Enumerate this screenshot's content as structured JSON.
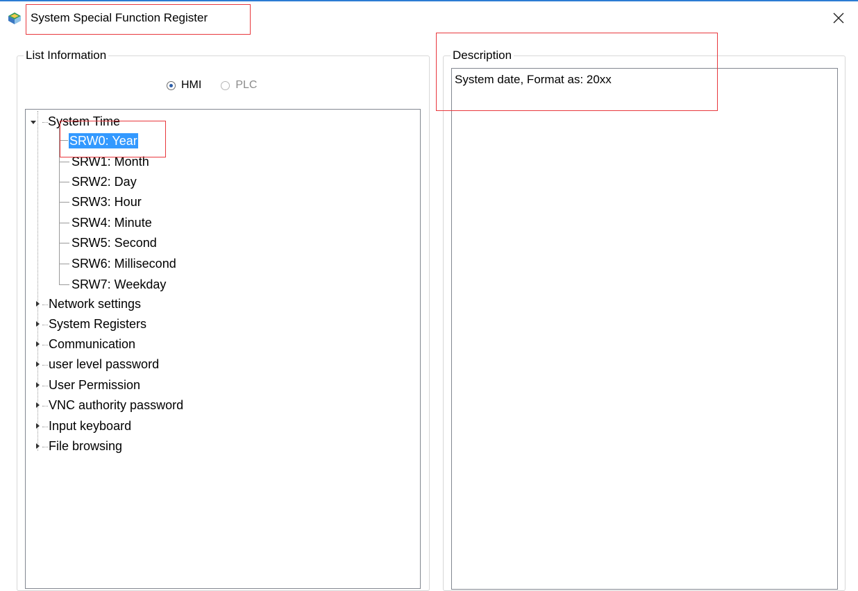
{
  "window": {
    "title": "System Special Function Register",
    "close_icon": "close-icon",
    "app_icon": "app-logo-icon"
  },
  "list_group": {
    "legend": "List Information",
    "radio_hmi": "HMI",
    "radio_plc": "PLC",
    "selected": "HMI"
  },
  "tree": {
    "nodes": [
      {
        "label": "System Time",
        "expanded": true
      },
      {
        "label": "Network settings"
      },
      {
        "label": "System Registers"
      },
      {
        "label": "Communication"
      },
      {
        "label": "user level password"
      },
      {
        "label": "User Permission"
      },
      {
        "label": "VNC authority password"
      },
      {
        "label": "Input keyboard"
      },
      {
        "label": "File browsing"
      }
    ],
    "children": [
      {
        "label": "SRW0: Year",
        "selected": true
      },
      {
        "label": "SRW1: Month"
      },
      {
        "label": "SRW2: Day"
      },
      {
        "label": "SRW3: Hour"
      },
      {
        "label": "SRW4: Minute"
      },
      {
        "label": "SRW5: Second"
      },
      {
        "label": "SRW6: Millisecond"
      },
      {
        "label": "SRW7: Weekday"
      }
    ]
  },
  "description_group": {
    "legend": "Description",
    "text": "System date,  Format as:  20xx"
  },
  "colors": {
    "highlight_box": "#e8373c",
    "selection": "#3399ff",
    "title_bar_border": "#2b7cd3"
  }
}
